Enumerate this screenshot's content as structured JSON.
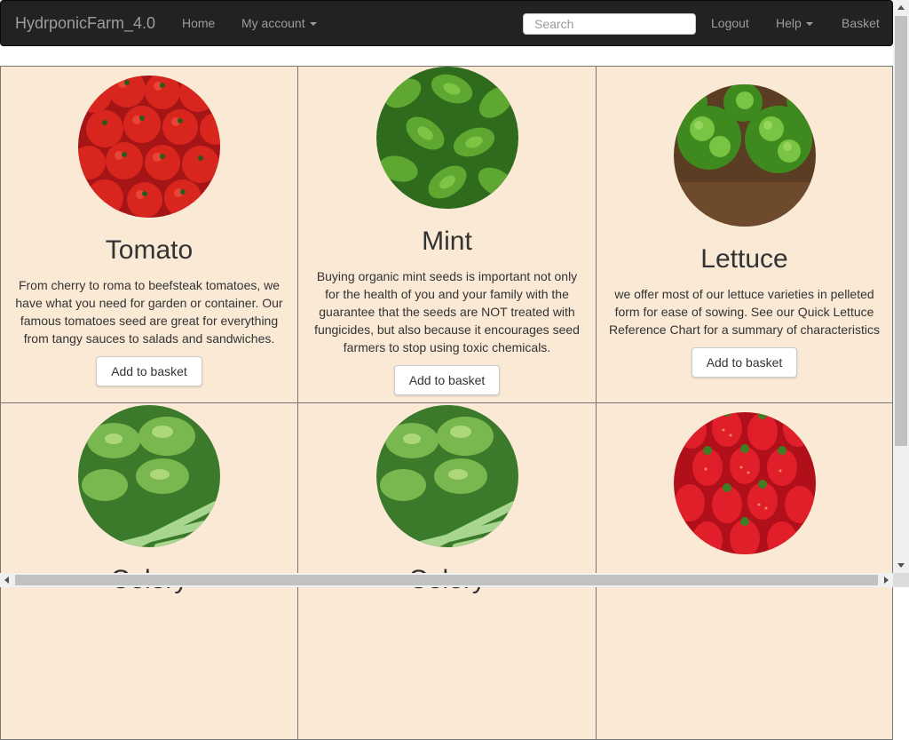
{
  "navbar": {
    "brand": "HydrponicFarm_4.0",
    "home": "Home",
    "my_account": "My account",
    "search_placeholder": "Search",
    "logout": "Logout",
    "help": "Help",
    "basket": "Basket",
    "bg_color": "#222222",
    "link_color": "#9d9d9d"
  },
  "products": [
    {
      "name": "Tomato",
      "description": "From cherry to roma to beefsteak tomatoes, we have what you need for garden or container. Our famous tomatoes seed are great for everything from tangy sauces to salads and sandwiches.",
      "button": "Add to basket",
      "image": "tomato-image"
    },
    {
      "name": "Mint",
      "description": "Buying organic mint seeds is important not only for the health of you and your family with the guarantee that the seeds are NOT treated with fungicides, but also because it encourages seed farmers to stop using toxic chemicals.",
      "button": "Add to basket",
      "image": "mint-image"
    },
    {
      "name": "Lettuce",
      "description": "we offer most of our lettuce varieties in pelleted form for ease of sowing. See our Quick Lettuce Reference Chart for a summary of characteristics",
      "button": "Add to basket",
      "image": "lettuce-image"
    },
    {
      "name": "Celery",
      "description": "",
      "button": "",
      "image": "celery-image"
    },
    {
      "name": "Celery",
      "description": "",
      "button": "",
      "image": "celery-image"
    },
    {
      "name": "",
      "description": "",
      "button": "",
      "image": "strawberry-image"
    }
  ],
  "colors": {
    "card_bg": "#fae9d5",
    "card_border": "#777777"
  }
}
